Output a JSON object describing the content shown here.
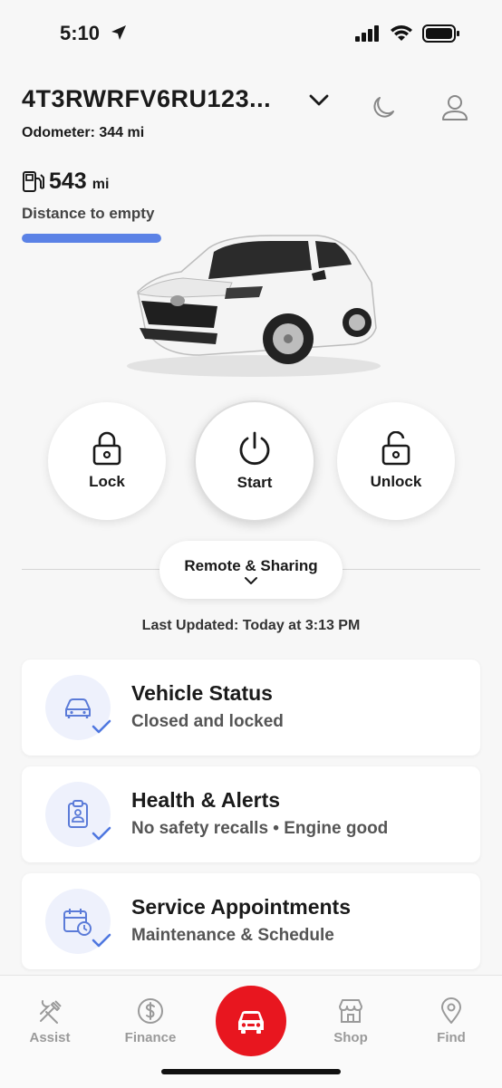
{
  "status_bar": {
    "time": "5:10"
  },
  "header": {
    "vin": "4T3RWRFV6RU123...",
    "odometer": "Odometer: 344 mi"
  },
  "fuel": {
    "range_value": "543",
    "range_unit": "mi",
    "label": "Distance to empty",
    "level_fraction": 1.0
  },
  "actions": {
    "lock": "Lock",
    "start": "Start",
    "unlock": "Unlock"
  },
  "remote": {
    "label": "Remote & Sharing"
  },
  "last_updated": "Last Updated: Today at 3:13 PM",
  "cards": [
    {
      "title": "Vehicle Status",
      "subtitle": "Closed and locked",
      "icon": "car-icon"
    },
    {
      "title": "Health & Alerts",
      "subtitle": "No safety recalls • Engine good",
      "icon": "clipboard-icon"
    },
    {
      "title": "Service Appointments",
      "subtitle": "Maintenance & Schedule",
      "icon": "calendar-clock-icon"
    }
  ],
  "tabs": {
    "assist": "Assist",
    "finance": "Finance",
    "shop": "Shop",
    "find": "Find"
  },
  "colors": {
    "accent_blue": "#5b82e6",
    "brand_red": "#e8161f",
    "icon_bg": "#eef1fc"
  }
}
